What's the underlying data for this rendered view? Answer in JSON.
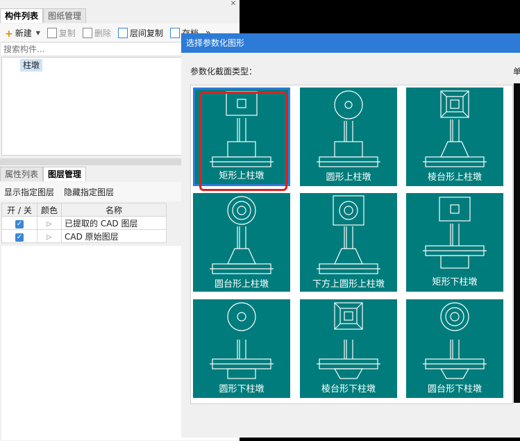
{
  "left_panel": {
    "top_tabs": [
      "构件列表",
      "图纸管理"
    ],
    "toolbar": {
      "new": "新建",
      "copy": "复制",
      "delete": "删除",
      "floor_copy": "层间复制",
      "archive": "存档",
      "more": "»"
    },
    "search_placeholder": "搜索构件...",
    "tree_item": "柱墩",
    "bottom_tabs": [
      "属性列表",
      "图层管理"
    ],
    "layer_actions": {
      "show": "显示指定图层",
      "hide": "隐藏指定图层"
    },
    "layer_table": {
      "headers": [
        "开 / 关",
        "颜色",
        "名称"
      ],
      "rows": [
        {
          "checked": true,
          "name": "已提取的 CAD 图层"
        },
        {
          "checked": true,
          "name": "CAD 原始图层"
        }
      ]
    }
  },
  "dialog": {
    "title": "选择参数化图形",
    "section_label": "参数化截面类型：",
    "right_label": "单",
    "options": [
      {
        "label": "矩形上柱墩",
        "selected": true
      },
      {
        "label": "圆形上柱墩",
        "selected": false
      },
      {
        "label": "棱台形上柱墩",
        "selected": false
      },
      {
        "label": "圆台形上柱墩",
        "selected": false
      },
      {
        "label": "下方上圆形上柱墩",
        "selected": false
      },
      {
        "label": "矩形下柱墩",
        "selected": false
      },
      {
        "label": "圆形下柱墩",
        "selected": false
      },
      {
        "label": "棱台形下柱墩",
        "selected": false
      },
      {
        "label": "圆台形下柱墩",
        "selected": false
      }
    ]
  },
  "colors": {
    "teal": "#007c7c",
    "title_blue": "#2d7bd6",
    "highlight_red": "#e02020"
  }
}
